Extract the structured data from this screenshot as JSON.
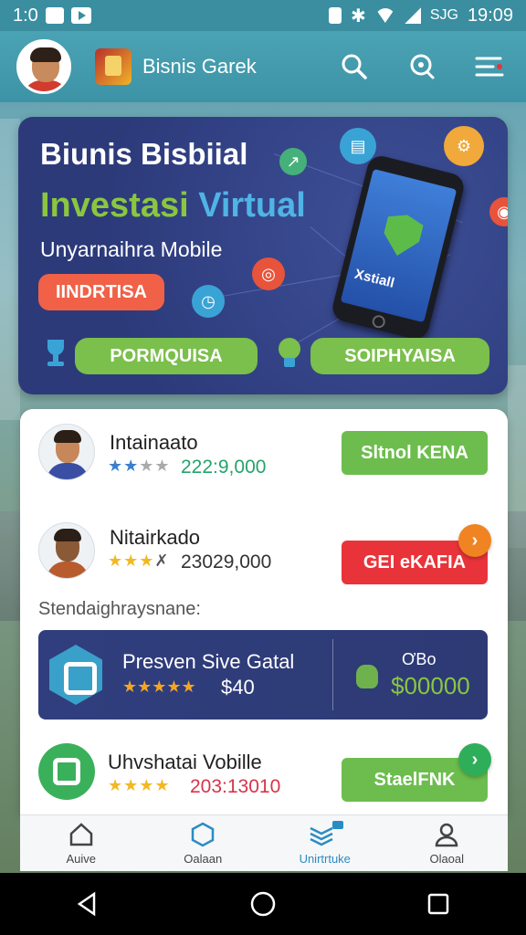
{
  "status_bar": {
    "time_left": "1:0",
    "right_text": "SJG",
    "clock": "19:09"
  },
  "header": {
    "app_title": "Bisnis Garek",
    "icons": [
      "search-icon",
      "notification-search-icon",
      "menu-icon"
    ]
  },
  "banner": {
    "title": "Biunis Bisbiial",
    "headline_green": "Investasi",
    "headline_blue": "Virtual",
    "subtitle": "Unyarnaihra Mobile",
    "primary_button": "IINDRTISA",
    "button_left": "PORMQUISA",
    "button_right": "SOIPHYAISA",
    "phone_text": "Xstiall"
  },
  "list": {
    "items": [
      {
        "name": "Intainaato",
        "value": "222:9,000",
        "button": "Sltnol KENA",
        "button_color": "#6cbd4d",
        "rating": 2
      },
      {
        "name": "Nitairkado",
        "value": "23029,000",
        "button": "GEI eKAFIA",
        "button_color": "#e9333a",
        "rating": 3
      },
      {
        "name": "Uhvshatai Vobille",
        "value": "203:13010",
        "button": "StaelFNK",
        "button_color": "#6cbd4d",
        "rating": 4
      }
    ],
    "section_label": "Stendaighraysnane:",
    "promo": {
      "title": "Presven Sive Gatal",
      "price": "$40",
      "small_label": "ƠBo",
      "amount": "$00000"
    }
  },
  "bottom_nav": {
    "items": [
      {
        "label": "Auive",
        "icon": "home-icon"
      },
      {
        "label": "Oalaan",
        "icon": "hexagon-icon"
      },
      {
        "label": "Unirtrtuke",
        "icon": "layers-icon"
      },
      {
        "label": "Olaoal",
        "icon": "profile-icon"
      }
    ],
    "active_index": 2
  },
  "colors": {
    "header": "#3d93a6",
    "banner": "#2c3a7a",
    "accent_green": "#6cbd4d",
    "accent_red": "#e9333a",
    "accent_orange": "#f06147"
  }
}
